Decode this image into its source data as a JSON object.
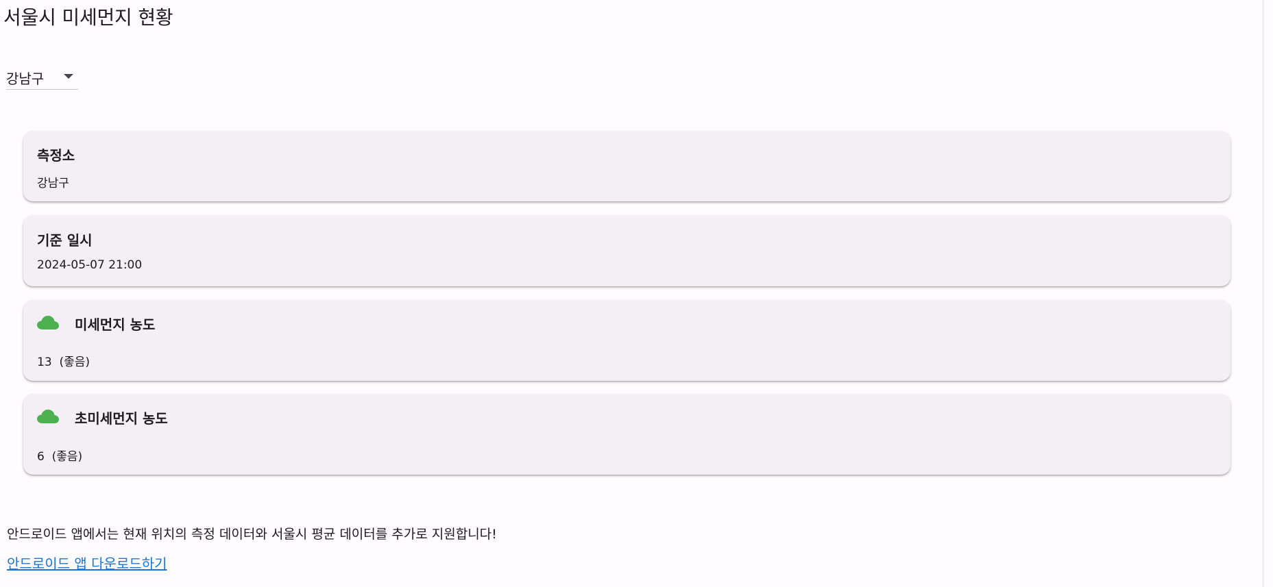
{
  "page": {
    "title": "서울시 미세먼지 현황"
  },
  "district_select": {
    "value": "강남구"
  },
  "cards": {
    "station": {
      "title": "측정소",
      "value": "강남구"
    },
    "datetime": {
      "title": "기준 일시",
      "value": "2024-05-07 21:00"
    },
    "pm10": {
      "icon": "cloud-icon",
      "title": "미세먼지 농도",
      "value": "13  (좋음)",
      "status_color": "#4caf50"
    },
    "pm25": {
      "icon": "cloud-icon",
      "title": "초미세먼지 농도",
      "value": "6  (좋음)",
      "status_color": "#4caf50"
    }
  },
  "footer": {
    "notice": "안드로이드 앱에서는 현재 위치의 측정 데이터와 서울시 평균 데이터를 추가로 지원합니다!",
    "link_label": "안드로이드 앱 다운로드하기"
  }
}
